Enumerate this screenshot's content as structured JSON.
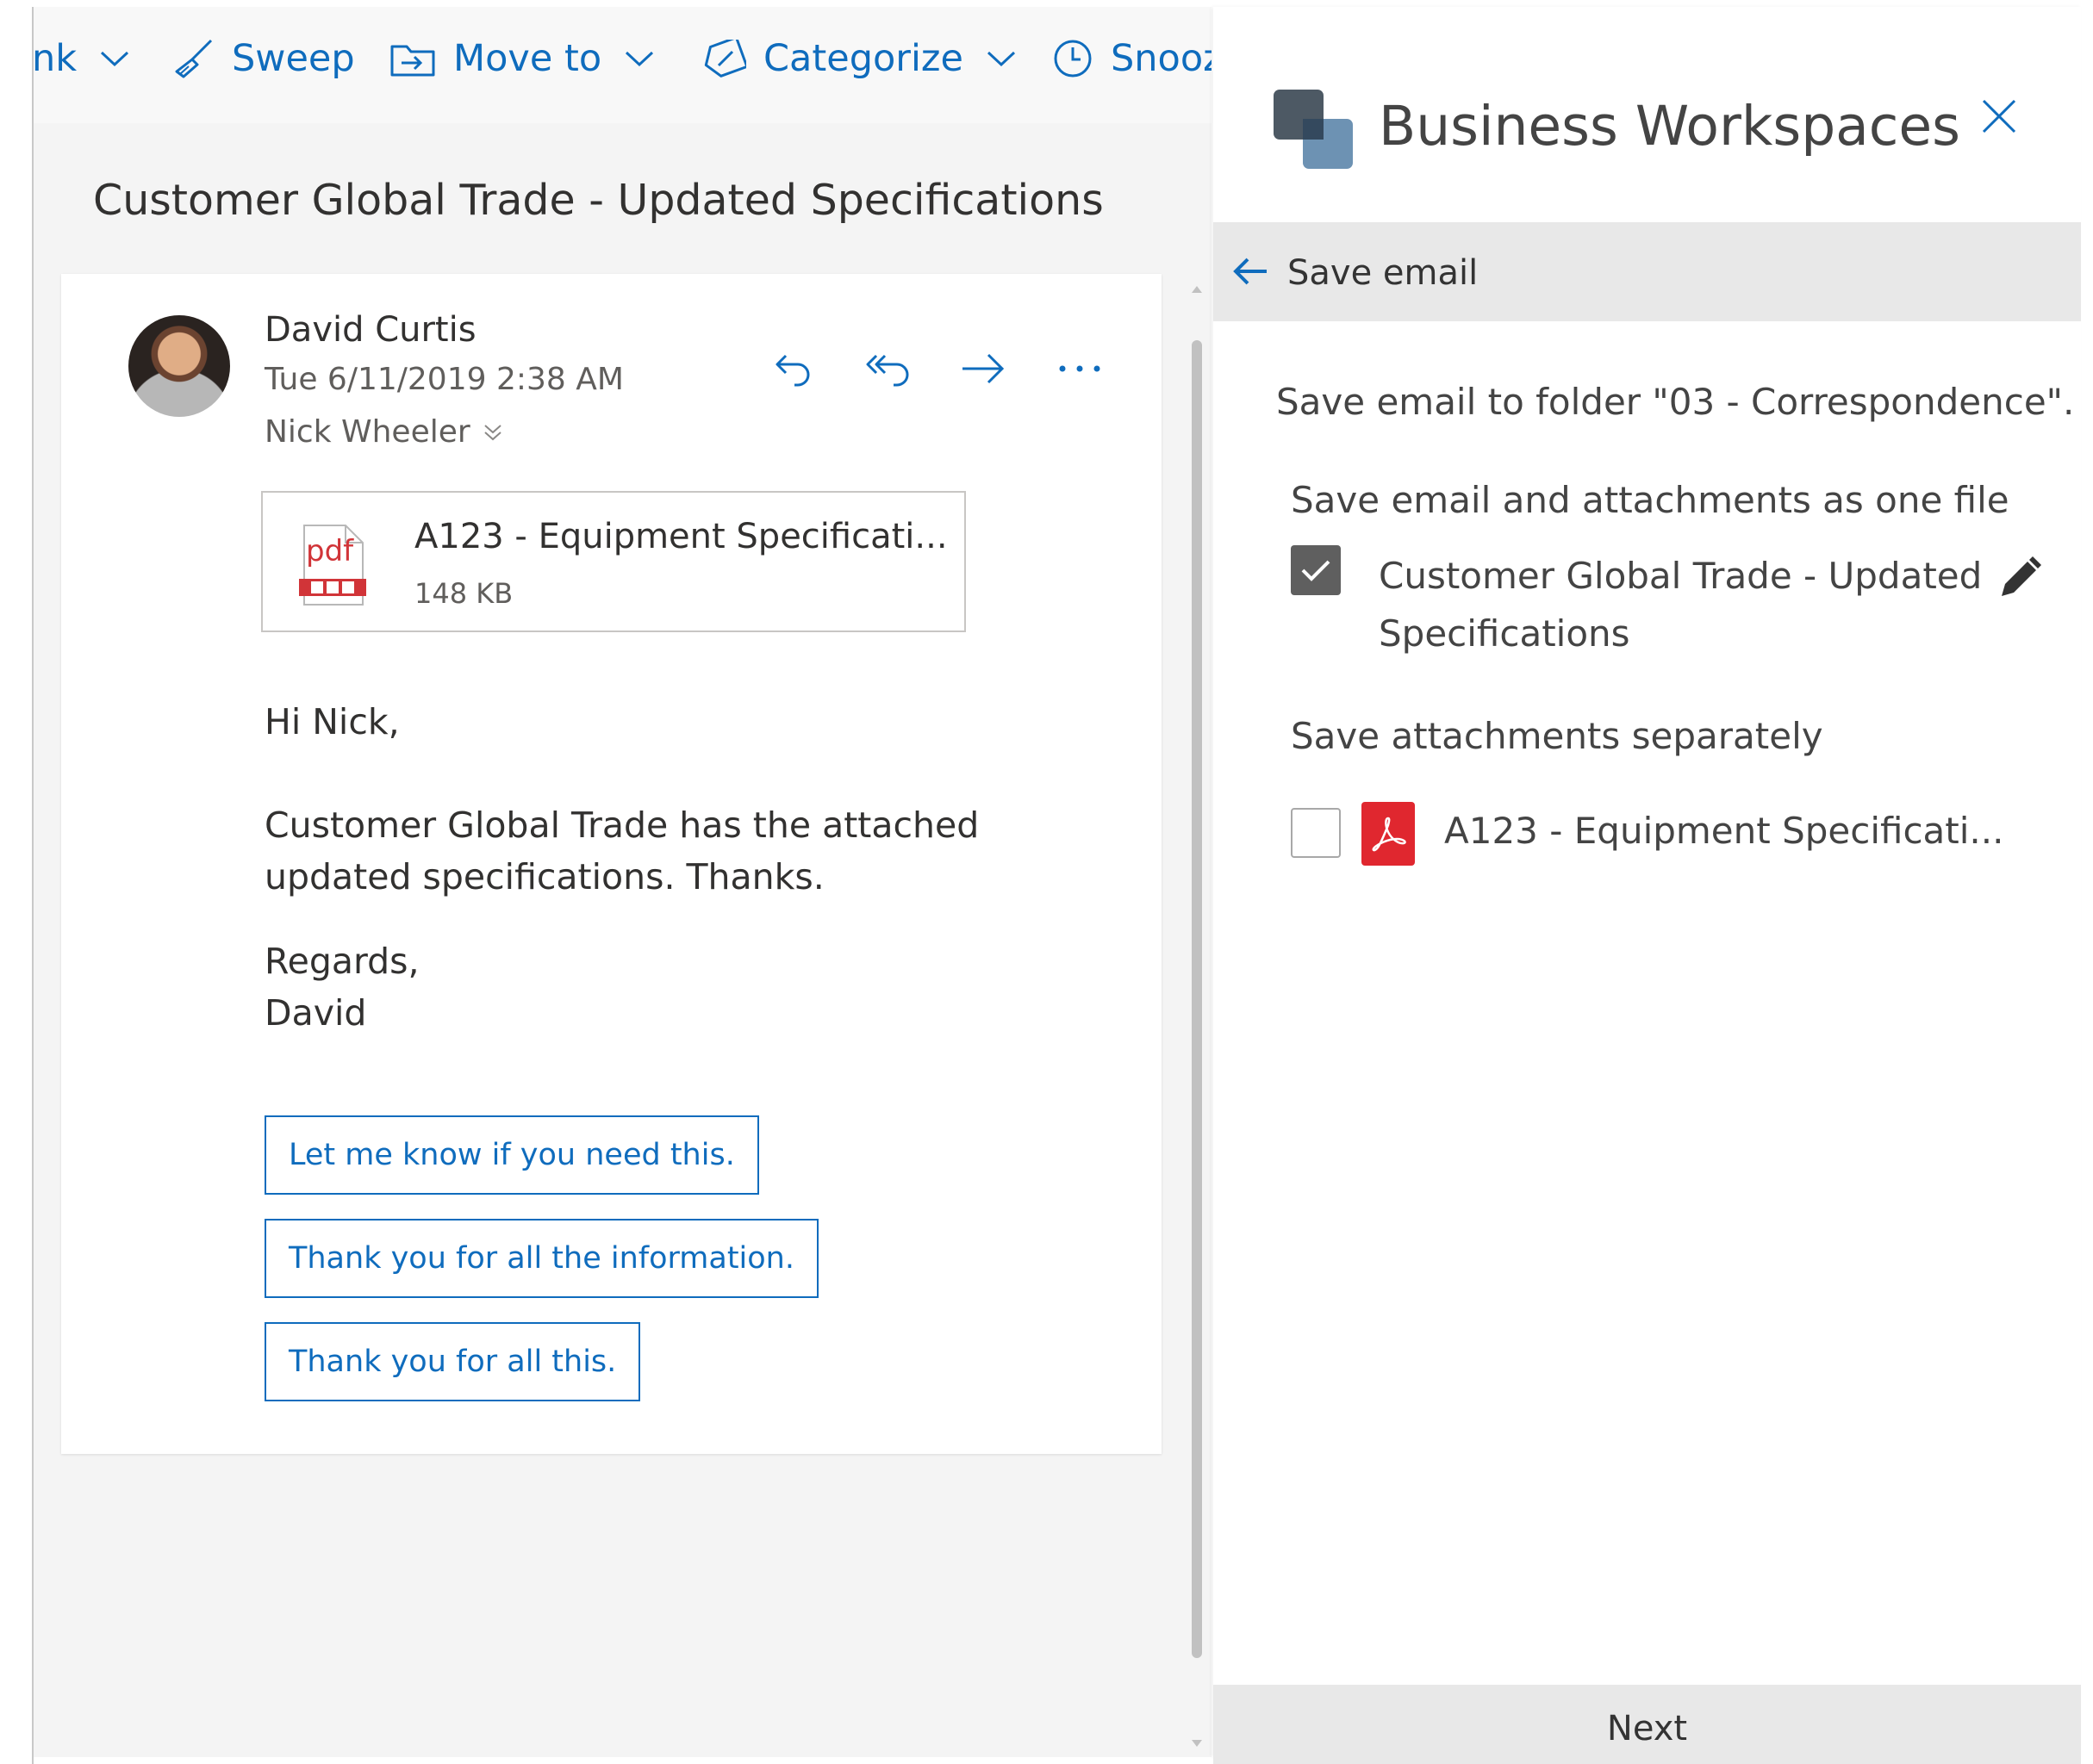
{
  "toolbar": {
    "items": [
      {
        "label": "nk",
        "icon": "chevron-down-icon"
      },
      {
        "label": "Sweep",
        "icon": "broom-icon"
      },
      {
        "label": "Move to",
        "icon": "folder-move-icon"
      },
      {
        "label": "Categorize",
        "icon": "tag-icon"
      },
      {
        "label": "Snooz",
        "icon": "clock-icon"
      }
    ]
  },
  "message": {
    "subject": "Customer Global Trade - Updated Specifications",
    "sender": "David Curtis",
    "date": "Tue 6/11/2019 2:38 AM",
    "recipient": "Nick Wheeler",
    "attachment": {
      "name": "A123 - Equipment Specificati...",
      "size": "148 KB",
      "type_label": "pdf"
    },
    "body": {
      "greeting": "Hi Nick,",
      "line1": "Customer Global Trade has the attached",
      "line2": "updated specifications. Thanks.",
      "closing": "Regards,",
      "signature": "David"
    },
    "suggested_replies": [
      "Let me know if you need this.",
      "Thank you for all the information.",
      "Thank you for all this."
    ]
  },
  "addin": {
    "title": "Business Workspaces",
    "back_label": "Save email",
    "folder_text": "Save email to folder \"03 - Correspondence\".",
    "one_file_heading": "Save email and attachments as one file",
    "email_item_line1": "Customer Global Trade - Updated",
    "email_item_line2": "Specifications",
    "email_item_checked": true,
    "separate_heading": "Save attachments separately",
    "attachment_item": "A123 - Equipment Specificati...",
    "attachment_item_checked": false,
    "next_label": "Next"
  },
  "colors": {
    "accent_blue": "#0f6cbd",
    "pdf_red": "#e0272f",
    "checkbox_checked": "#5f5f5f"
  }
}
